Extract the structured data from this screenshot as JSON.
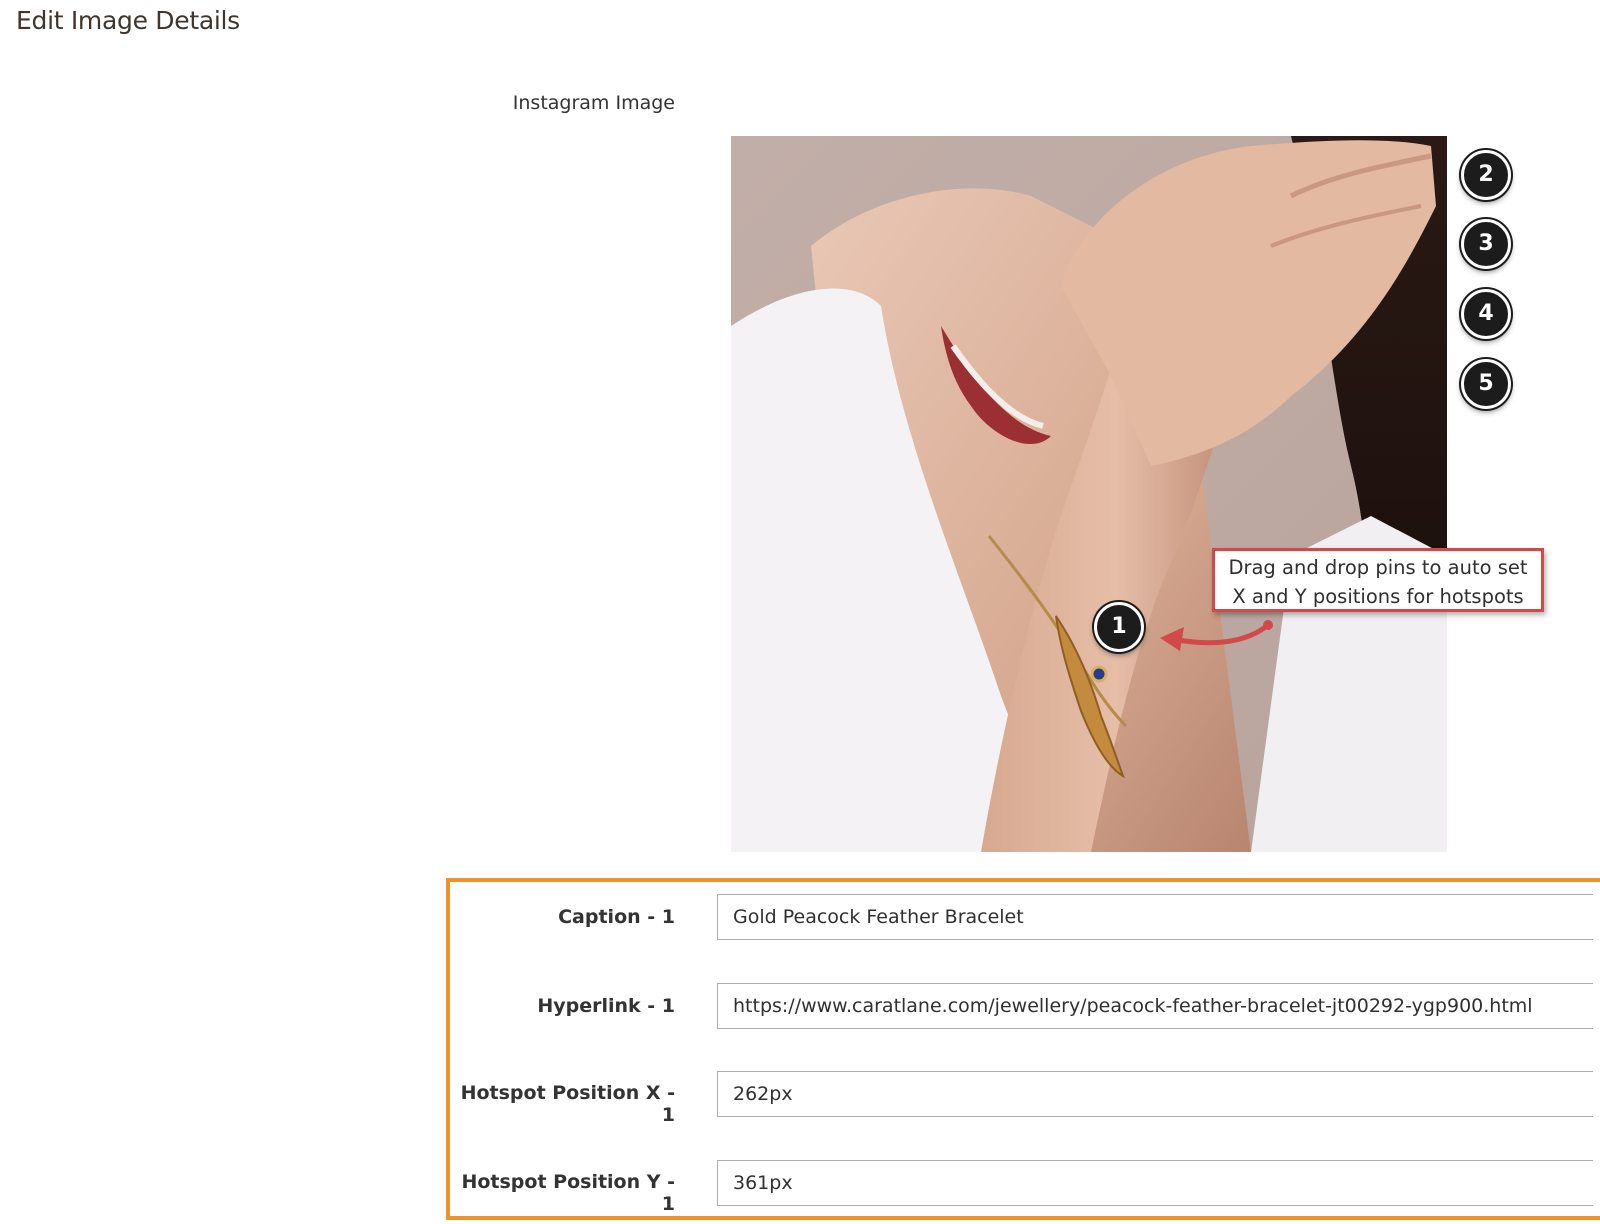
{
  "page": {
    "title": "Edit Image Details"
  },
  "image_field": {
    "label": "Instagram Image"
  },
  "hotspots": {
    "pins": [
      {
        "number": "1"
      },
      {
        "number": "2"
      },
      {
        "number": "3"
      },
      {
        "number": "4"
      },
      {
        "number": "5"
      }
    ]
  },
  "callout": {
    "line1": "Drag and drop pins to auto set",
    "line2": "X and Y positions for hotspots"
  },
  "form": {
    "caption": {
      "label": "Caption - 1",
      "value": "Gold Peacock Feather Bracelet"
    },
    "hyperlink": {
      "label": "Hyperlink - 1",
      "value": "https://www.caratlane.com/jewellery/peacock-feather-bracelet-jt00292-ygp900.html"
    },
    "pos_x": {
      "label": "Hotspot Position X - 1",
      "value": "262px"
    },
    "pos_y": {
      "label": "Hotspot Position Y - 1",
      "value": "361px"
    }
  },
  "colors": {
    "highlight_border": "#ef922b",
    "callout_border": "#d24949",
    "pin_fill": "#1c1c1c"
  }
}
